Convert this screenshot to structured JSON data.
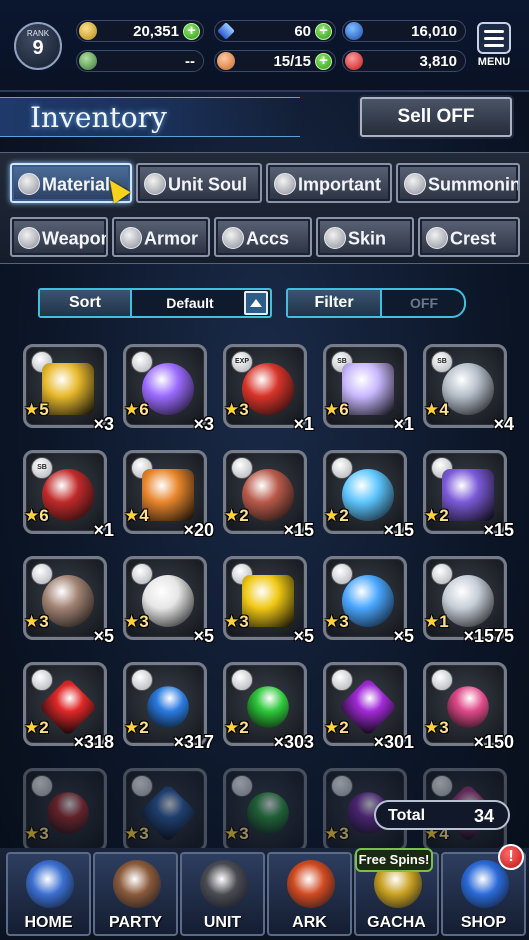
{
  "header": {
    "rank_label": "RANK",
    "rank_value": "9",
    "gil": "20,351",
    "lapis": "60",
    "blue_currency": "16,010",
    "bar4_value": "--",
    "energy": "15/15",
    "red_currency": "3,810",
    "menu_label": "MENU"
  },
  "page": {
    "title": "Inventory",
    "sell_off": "Sell OFF"
  },
  "tabs_row1": [
    {
      "label": "Material",
      "icon": "bag-icon"
    },
    {
      "label": "Unit Soul",
      "icon": "soul-icon"
    },
    {
      "label": "Important",
      "icon": "star-icon"
    },
    {
      "label": "Summoning",
      "icon": "summon-icon"
    }
  ],
  "tabs_row2": [
    {
      "label": "Weapon",
      "icon": "sword-icon"
    },
    {
      "label": "Armor",
      "icon": "armor-icon"
    },
    {
      "label": "Accs",
      "icon": "necklace-icon"
    },
    {
      "label": "Skin",
      "icon": "hanger-icon"
    },
    {
      "label": "Crest",
      "icon": "crest-icon"
    }
  ],
  "sort": {
    "label": "Sort",
    "value": "Default"
  },
  "filter": {
    "label": "Filter",
    "value": "OFF"
  },
  "items": [
    {
      "name": "gold-bars",
      "badge": "",
      "stars": 5,
      "qty": "×3",
      "color": "#e8b92c"
    },
    {
      "name": "rainbow-orb",
      "badge": "",
      "stars": 6,
      "qty": "×3",
      "color": "#9b6bff"
    },
    {
      "name": "exp-potion",
      "badge": "EXP",
      "stars": 3,
      "qty": "×1",
      "color": "#d8342a"
    },
    {
      "name": "prism-crystal",
      "badge": "SB",
      "stars": 6,
      "qty": "×1",
      "color": "#c9b8ff"
    },
    {
      "name": "silver-ticket",
      "badge": "SB",
      "stars": 4,
      "qty": "×4",
      "color": "#b5bec9"
    },
    {
      "name": "red-ore",
      "badge": "SB",
      "stars": 6,
      "qty": "×1",
      "color": "#c02a2a"
    },
    {
      "name": "elixir-flask",
      "badge": "",
      "stars": 4,
      "qty": "×20",
      "color": "#e8862c"
    },
    {
      "name": "raw-meat",
      "badge": "",
      "stars": 2,
      "qty": "×15",
      "color": "#b85a4a"
    },
    {
      "name": "water-vial",
      "badge": "",
      "stars": 2,
      "qty": "×15",
      "color": "#5ec6ff"
    },
    {
      "name": "purple-crystal",
      "badge": "",
      "stars": 2,
      "qty": "×15",
      "color": "#7b5ad8"
    },
    {
      "name": "serpent-tail",
      "badge": "",
      "stars": 3,
      "qty": "×5",
      "color": "#a08272"
    },
    {
      "name": "red-paper",
      "badge": "",
      "stars": 3,
      "qty": "×5",
      "color": "#e6e6e6"
    },
    {
      "name": "golden-apple",
      "badge": "",
      "stars": 3,
      "qty": "×5",
      "color": "#f0c814"
    },
    {
      "name": "blue-bone",
      "badge": "",
      "stars": 3,
      "qty": "×5",
      "color": "#4aa6ff"
    },
    {
      "name": "silver-shard",
      "badge": "",
      "stars": 1,
      "qty": "×1575",
      "color": "#c7ced8"
    },
    {
      "name": "red-megacryst",
      "badge": "",
      "stars": 2,
      "qty": "×318",
      "color": "#e02828"
    },
    {
      "name": "blue-megacryst",
      "badge": "",
      "stars": 2,
      "qty": "×317",
      "color": "#2a7be0"
    },
    {
      "name": "green-megacryst",
      "badge": "",
      "stars": 2,
      "qty": "×303",
      "color": "#2ec83a"
    },
    {
      "name": "purple-megacryst",
      "badge": "",
      "stars": 2,
      "qty": "×301",
      "color": "#a22ad8"
    },
    {
      "name": "rainbow-megacryst",
      "badge": "",
      "stars": 3,
      "qty": "×150",
      "color": "#e04a8a"
    },
    {
      "name": "red-cryst",
      "badge": "",
      "stars": 3,
      "qty": "",
      "color": "#a83030",
      "faded": true
    },
    {
      "name": "blue-cryst",
      "badge": "",
      "stars": 3,
      "qty": "",
      "color": "#3060a8",
      "faded": true
    },
    {
      "name": "green-cryst",
      "badge": "",
      "stars": 3,
      "qty": "",
      "color": "#309a40",
      "faded": true
    },
    {
      "name": "purple-cryst",
      "badge": "",
      "stars": 3,
      "qty": "",
      "color": "#7a30a8",
      "faded": true
    },
    {
      "name": "pink-cryst",
      "badge": "",
      "stars": 4,
      "qty": "",
      "color": "#b04088",
      "faded": true
    }
  ],
  "total": {
    "label": "Total",
    "value": "34"
  },
  "nav": [
    {
      "label": "HOME",
      "color": "#3b6fd0"
    },
    {
      "label": "PARTY",
      "color": "#8a5a3a"
    },
    {
      "label": "UNIT",
      "color": "#4a4a52"
    },
    {
      "label": "ARK",
      "color": "#d04a20"
    },
    {
      "label": "GACHA",
      "color": "#c8a020"
    },
    {
      "label": "SHOP",
      "color": "#2a6ad8"
    }
  ],
  "gacha_promo": "Free Spins!",
  "shop_alert": "!"
}
